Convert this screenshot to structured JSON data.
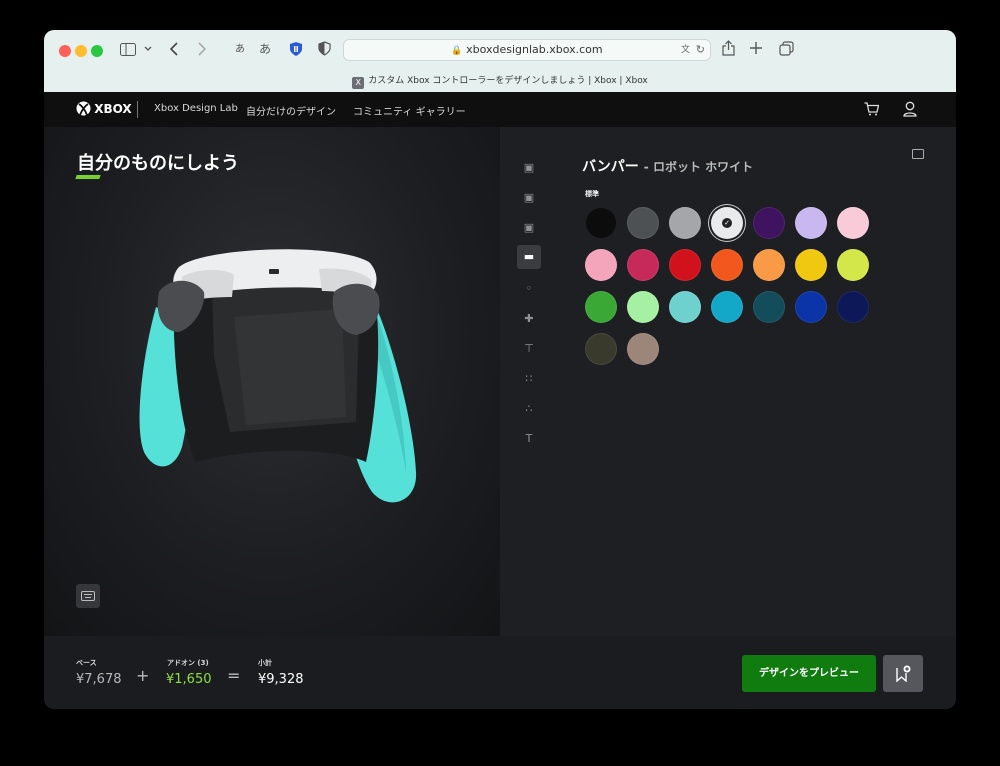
{
  "browser": {
    "url": "xboxdesignlab.xbox.com",
    "tab_title": "カスタム Xbox コントローラーをデザインしましょう | Xbox | Xbox",
    "tab_icon": "X",
    "text_size_small": "あ",
    "text_size_large": "あ"
  },
  "nav": {
    "logo": "XBOX",
    "items": [
      "Xbox Design Lab",
      "自分だけのデザイン",
      "コミュニティ ギャラリー"
    ]
  },
  "left": {
    "title": "自分のものにしよう"
  },
  "right": {
    "section": "バンパー",
    "color_name": "- ロボット ホワイト",
    "group_label": "標準",
    "swatches": [
      "#0c0c0c",
      "#4e5154",
      "#a4a6a9",
      "#e8eaec",
      "#3f1360",
      "#c9b7f0",
      "#f9cbd8",
      "#f4a5bc",
      "#c72a5a",
      "#d1121d",
      "#f2581d",
      "#f89a46",
      "#f0c812",
      "#d3e74a",
      "#3aa834",
      "#a5f0a2",
      "#6fd1cd",
      "#14a8c8",
      "#134c5a",
      "#0a34a8",
      "#0d1858",
      "#3a3a2c",
      "#9c8579"
    ],
    "selected_index": 3
  },
  "footer": {
    "base_label": "ベース",
    "base_value": "¥7,678",
    "addon_label": "アドオン (3)",
    "addon_value": "¥1,650",
    "subtotal_label": "小計",
    "subtotal_value": "¥9,328",
    "plus": "+",
    "equals": "=",
    "preview_button": "デザインをプレビュー"
  }
}
